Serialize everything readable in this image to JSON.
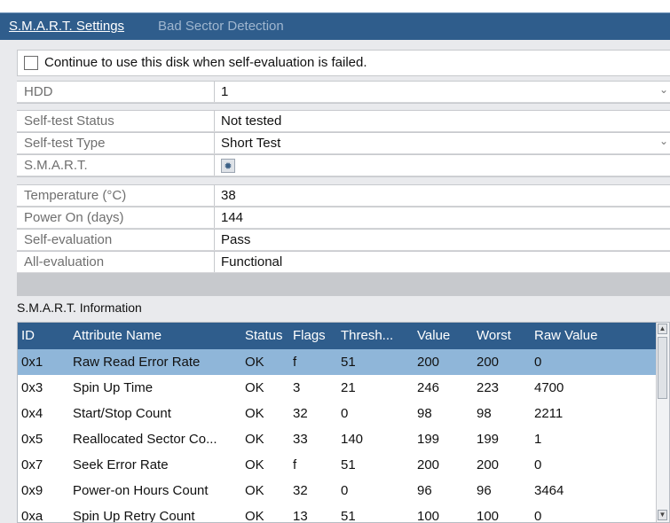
{
  "tabs": {
    "active": "S.M.A.R.T. Settings",
    "inactive": "Bad Sector Detection"
  },
  "continue_option": {
    "label": "Continue to use this disk when self-evaluation is failed.",
    "checked": false
  },
  "fields": {
    "hdd": {
      "label": "HDD",
      "value": "1"
    },
    "self_test_status": {
      "label": "Self-test Status",
      "value": "Not tested"
    },
    "self_test_type": {
      "label": "Self-test Type",
      "value": "Short Test"
    },
    "smart": {
      "label": "S.M.A.R.T.",
      "icon": "gear-icon"
    },
    "temperature": {
      "label": "Temperature (°C)",
      "value": "38"
    },
    "power_on": {
      "label": "Power On (days)",
      "value": "144"
    },
    "self_evaluation": {
      "label": "Self-evaluation",
      "value": "Pass"
    },
    "all_evaluation": {
      "label": "All-evaluation",
      "value": "Functional"
    }
  },
  "info_title": "S.M.A.R.T. Information",
  "table": {
    "columns": [
      "ID",
      "Attribute Name",
      "Status",
      "Flags",
      "Thresh...",
      "Value",
      "Worst",
      "Raw Value"
    ],
    "rows": [
      [
        "0x1",
        "Raw Read Error Rate",
        "OK",
        "f",
        "51",
        "200",
        "200",
        "0"
      ],
      [
        "0x3",
        "Spin Up Time",
        "OK",
        "3",
        "21",
        "246",
        "223",
        "4700"
      ],
      [
        "0x4",
        "Start/Stop Count",
        "OK",
        "32",
        "0",
        "98",
        "98",
        "2211"
      ],
      [
        "0x5",
        "Reallocated Sector Co...",
        "OK",
        "33",
        "140",
        "199",
        "199",
        "1"
      ],
      [
        "0x7",
        "Seek Error Rate",
        "OK",
        "f",
        "51",
        "200",
        "200",
        "0"
      ],
      [
        "0x9",
        "Power-on Hours Count",
        "OK",
        "32",
        "0",
        "96",
        "96",
        "3464"
      ],
      [
        "0xa",
        "Spin Up Retry Count",
        "OK",
        "13",
        "51",
        "100",
        "100",
        "0"
      ]
    ],
    "selected_row": 0
  },
  "colors": {
    "header_blue": "#2f5d8c",
    "selected_row": "#8fb6d9"
  }
}
